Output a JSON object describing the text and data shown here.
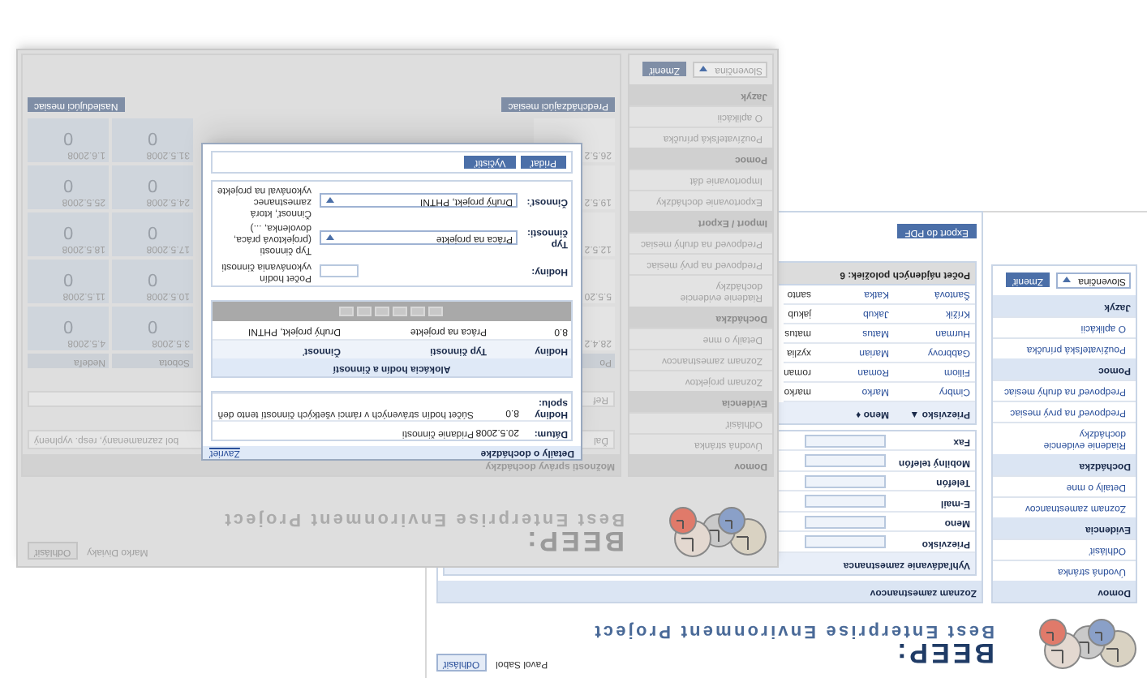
{
  "back_window": {
    "logo_title": "BEEP:",
    "logo_subtitle": "Best Enterprise Environment Project",
    "user": "Pavol Sabol",
    "logout": "Odhlásiť",
    "sidebar": [
      {
        "kind": "links",
        "heading": "Domov",
        "items": [
          "Úvodná stránka",
          "Odhlásiť"
        ]
      },
      {
        "kind": "links",
        "heading": "Evidencia",
        "items": [
          "Zoznam zamestnancov",
          "Detaily o mne"
        ]
      },
      {
        "kind": "links",
        "heading": "Dochádzka",
        "items": [
          "Riadenie evidencie dochádzky",
          "Predpoveď na prvý mesiac",
          "Predpoveď na druhý mesiac"
        ]
      },
      {
        "kind": "links",
        "heading": "Pomoc",
        "items": [
          "Používateľská príručka",
          "O aplikácii"
        ]
      },
      {
        "kind": "language",
        "heading": "Jazyk",
        "value": "Slovenčina",
        "button": "Zmeniť"
      }
    ],
    "page_title": "Zoznam zamestnancov",
    "search_title": "Vyhľadávanie zamestnanca",
    "search_fields": [
      "Priezvisko",
      "Meno",
      "E-mail",
      "Telefón",
      "Mobilný telefón",
      "Fax"
    ],
    "table": {
      "columns": [
        {
          "label": "Priezvisko",
          "sort": "▲"
        },
        {
          "label": "Meno",
          "sort": "♦"
        }
      ],
      "entries": [
        {
          "surname": "Cimbry",
          "first_name": "Marko",
          "column_3": "marko"
        },
        {
          "surname": "Filiom",
          "first_name": "Roman",
          "column_3": "roman"
        },
        {
          "surname": "Gabbrovy",
          "first_name": "Marian",
          "column_3": "xyzlia"
        },
        {
          "surname": "Hurman",
          "first_name": "Matus",
          "column_3": "matus"
        },
        {
          "surname": "Krížik",
          "first_name": "Jakub",
          "column_3": "jakub"
        },
        {
          "surname": "Šantová",
          "first_name": "Katka",
          "column_3": "santo"
        }
      ]
    },
    "count": "Počet nájdených položiek: 6",
    "export_button": "Export do PDF"
  },
  "front_window": {
    "logo_title": "BEEP:",
    "logo_subtitle": "Best Enterprise Environment Project",
    "user": "Marko Diviaky",
    "logout": "Odhlásiť",
    "sidebar": [
      {
        "kind": "links",
        "heading": "Domov",
        "items": [
          "Úvodná stránka",
          "Odhlásiť"
        ]
      },
      {
        "kind": "links",
        "heading": "Evidencia",
        "items": [
          "Zoznam projektov",
          "Zoznam zamestnancov",
          "Detaily o mne"
        ]
      },
      {
        "kind": "links",
        "heading": "Dochádzka",
        "items": [
          "Riadenie evidencie dochádzky",
          "Predpoveď na prvý mesiac",
          "Predpoveď na druhý mesiac"
        ]
      },
      {
        "kind": "links",
        "heading": "Import / Export",
        "items": [
          "Exportovanie dochádzky",
          "Importovanie dát"
        ]
      },
      {
        "kind": "links",
        "heading": "Pomoc",
        "items": [
          "Používateľská príručka",
          "O aplikácii"
        ]
      },
      {
        "kind": "language",
        "heading": "Jazyk",
        "value": "Slovenčina",
        "button": "Zmeniť"
      }
    ],
    "page_title": "Možnosti správy dochádzky",
    "notice_start": "Ďal",
    "notice_end": "bol zaznamenaný, resp. vyplnený",
    "filter_label": "Ref",
    "calendar": {
      "columns": [
        {
          "header": "Po",
          "cells": [
            {
              "date": "28.4.2"
            },
            {
              "date": "5.5.20"
            },
            {
              "date": "12.5.2"
            },
            {
              "date": "19.5.2"
            },
            {
              "date": "26.5.2"
            }
          ]
        },
        {
          "header": "Sobota",
          "cells": [
            {
              "date": "3.5.2008",
              "value": "0"
            },
            {
              "date": "10.5.2008",
              "value": "0"
            },
            {
              "date": "17.5.2008",
              "value": "0"
            },
            {
              "date": "24.5.2008",
              "value": "0"
            },
            {
              "date": "31.5.2008",
              "value": "0"
            }
          ]
        },
        {
          "header": "Nedeľa",
          "cells": [
            {
              "date": "4.5.2008",
              "value": "0"
            },
            {
              "date": "11.5.2008",
              "value": "0"
            },
            {
              "date": "18.5.2008",
              "value": "0"
            },
            {
              "date": "25.5.2008",
              "value": "0"
            },
            {
              "date": "1.6.2008",
              "value": "0"
            }
          ]
        }
      ]
    },
    "prev_button": "Predchádzajúci mesiac",
    "next_button": "Nasledujúci mesiac"
  },
  "dialog": {
    "title": "Detaily o dochádzke",
    "close": "Zavrieť",
    "info_rows": [
      {
        "label": "Dátum:",
        "value": "20.5.2008",
        "note": "Pridanie činnosti"
      },
      {
        "label": "Hodiny spolu:",
        "value": "8.0",
        "note": "Súčet hodín strávených v rámci všetkých činností tento deň"
      }
    ],
    "allocation": {
      "title": "Alokácia hodín a činností",
      "columns": [
        "Hodiny",
        "Typ činnosti",
        "Činnosť"
      ],
      "entries": [
        {
          "hours": "8.0",
          "type": "Práca na projekte",
          "activity": "Druhý projekt, PHTNI"
        }
      ]
    },
    "form": [
      {
        "kind": "input",
        "label": "Hodiny:",
        "description": "Počet hodín vykonávania činnosti"
      },
      {
        "kind": "select",
        "label": "Typ činnosti:",
        "value": "Práca na projekte",
        "description": "Typ činnosti (projektová práca, dovolenka, ...)"
      },
      {
        "kind": "select",
        "label": "Činnosť:",
        "value": "Druhý projekt, PHTNI",
        "description": "Činnosť, ktorá zamestnanec vykonával na projekte"
      }
    ],
    "buttons": [
      "Pridať",
      "Vyčistiť"
    ]
  }
}
